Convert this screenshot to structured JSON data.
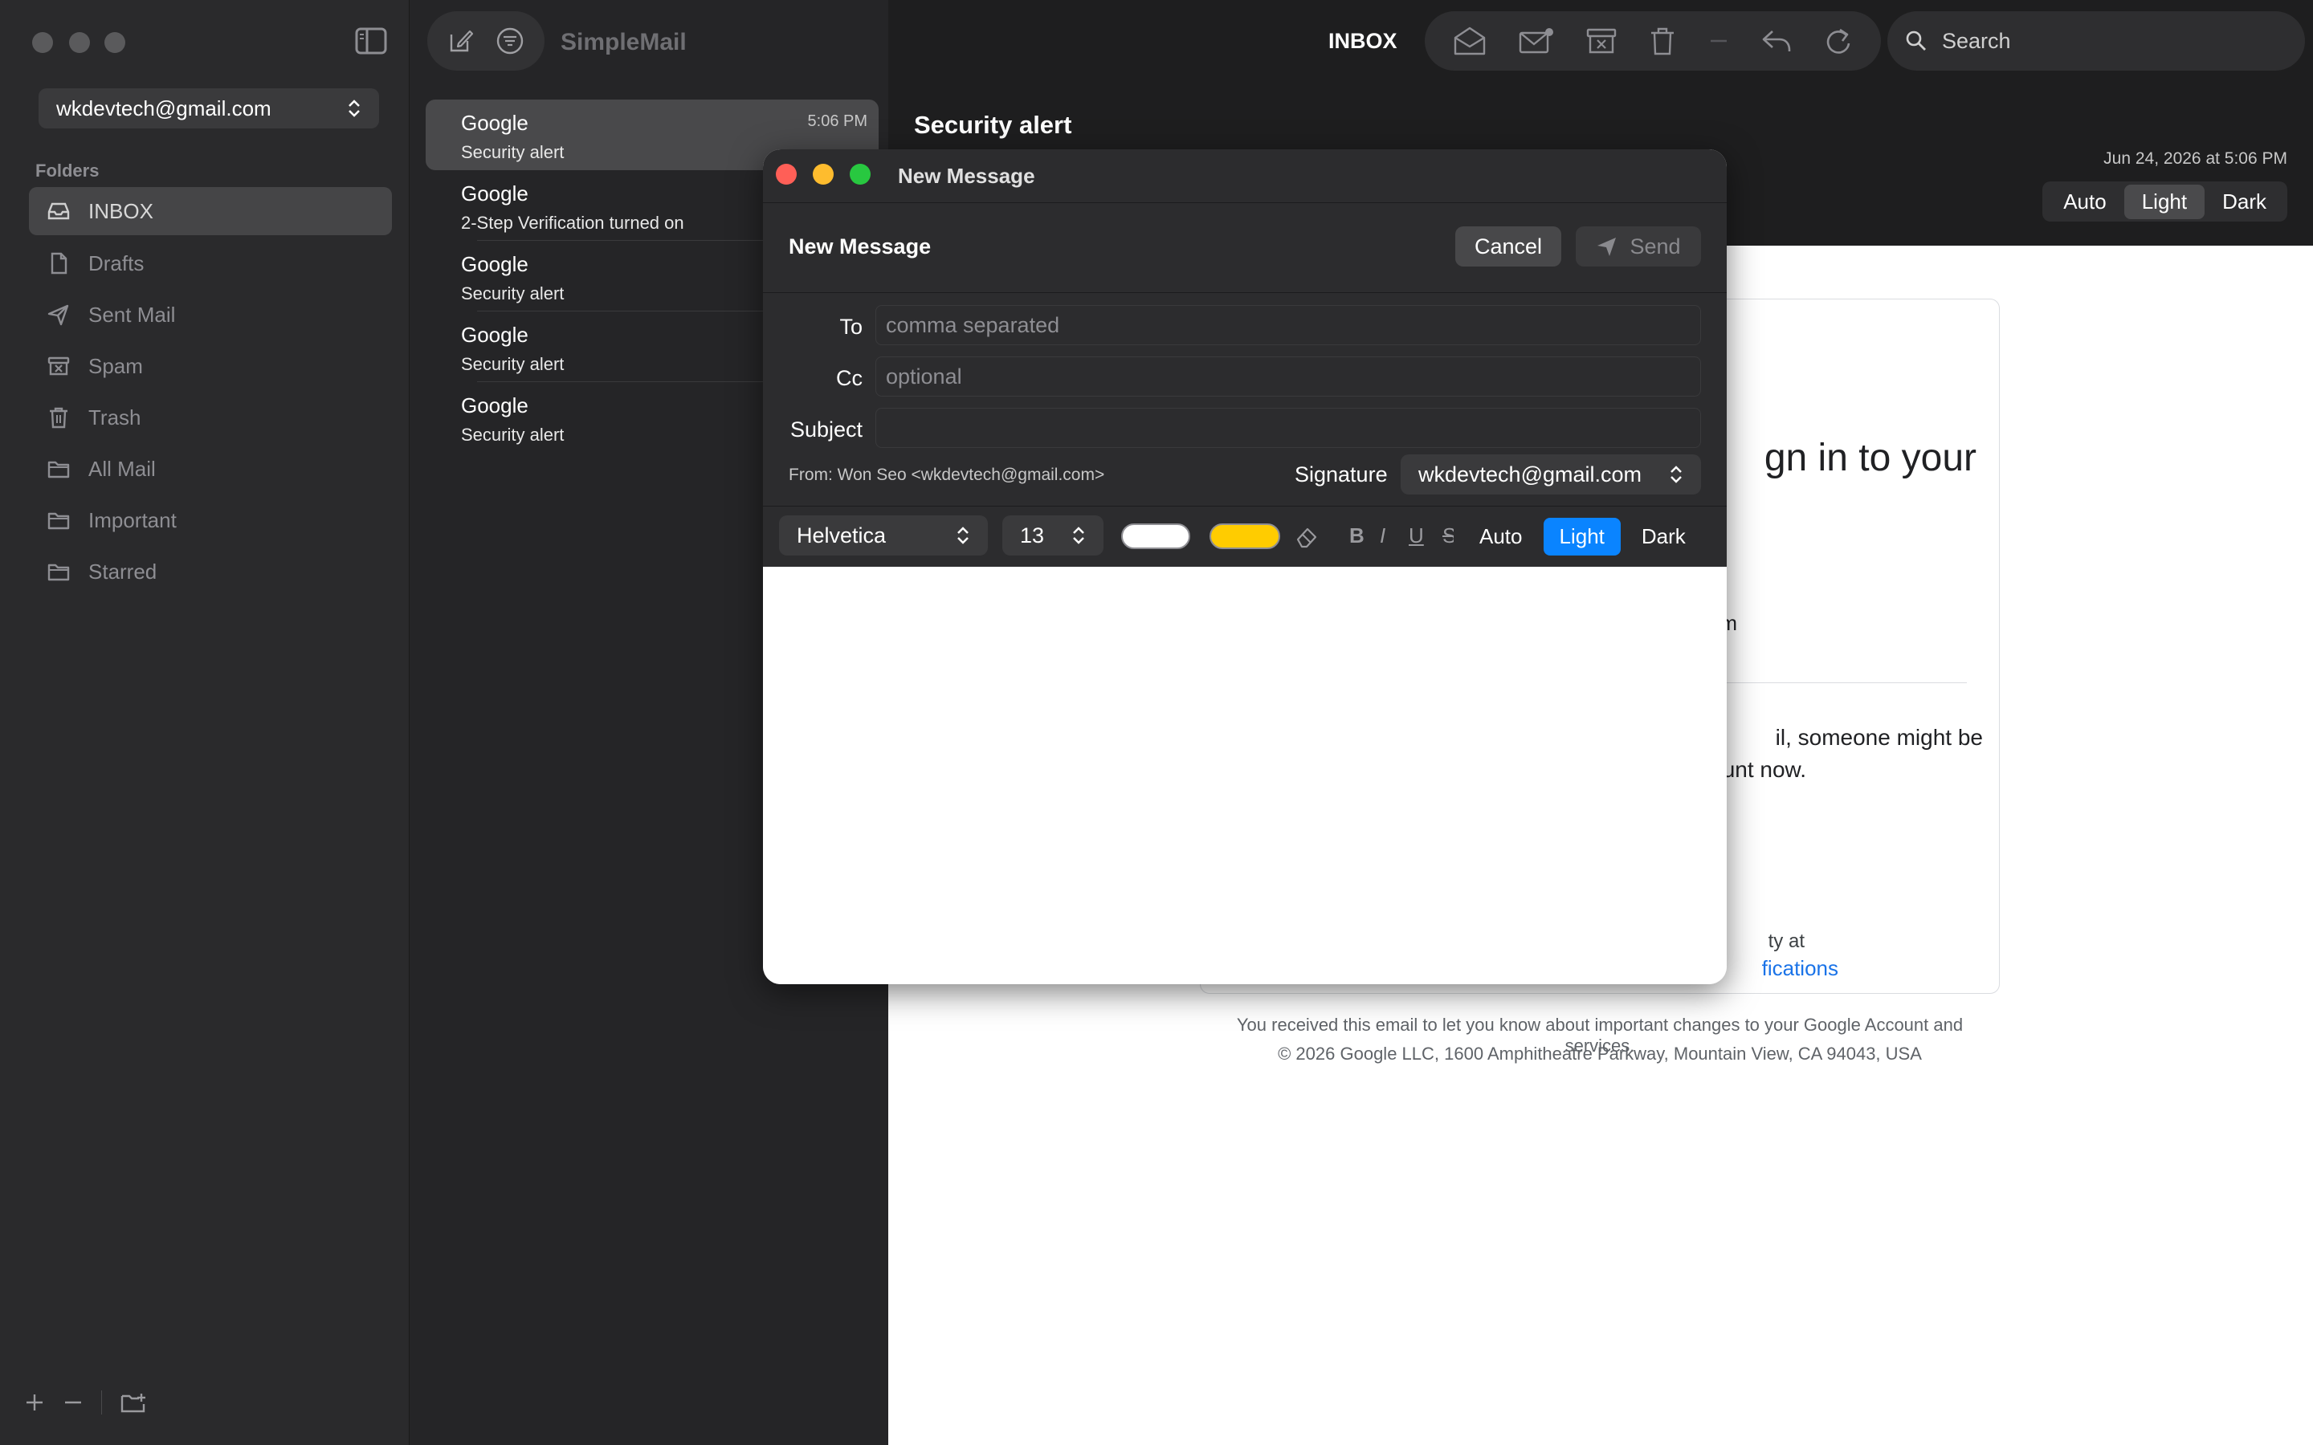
{
  "sidebar": {
    "account": "wkdevtech@gmail.com",
    "folders_label": "Folders",
    "folders": [
      {
        "label": "INBOX",
        "icon": "inbox-icon",
        "active": true
      },
      {
        "label": "Drafts",
        "icon": "document-icon"
      },
      {
        "label": "Sent Mail",
        "icon": "paperplane-icon"
      },
      {
        "label": "Spam",
        "icon": "spam-icon"
      },
      {
        "label": "Trash",
        "icon": "trash-icon"
      },
      {
        "label": "All Mail",
        "icon": "folder-icon"
      },
      {
        "label": "Important",
        "icon": "folder-icon"
      },
      {
        "label": "Starred",
        "icon": "folder-icon"
      }
    ]
  },
  "list": {
    "app_name": "SimpleMail",
    "messages": [
      {
        "sender": "Google",
        "subject": "Security alert",
        "time": "5:06 PM",
        "active": true
      },
      {
        "sender": "Google",
        "subject": "2-Step Verification turned on"
      },
      {
        "sender": "Google",
        "subject": "Security alert"
      },
      {
        "sender": "Google",
        "subject": "Security alert"
      },
      {
        "sender": "Google",
        "subject": "Security alert"
      }
    ]
  },
  "reader": {
    "mailbox": "INBOX",
    "search_placeholder": "Search",
    "subject": "Security alert",
    "date": "Jun 24, 2026 at 5:06 PM",
    "theme": {
      "auto": "Auto",
      "light": "Light",
      "dark": "Dark"
    },
    "card": {
      "heading_fragment": "gn in to your",
      "email_fragment": "m",
      "body_fragment_1": "il, someone might be",
      "body_fragment_2": "unt now.",
      "small_fragment": "ty at",
      "link_fragment": "fications"
    },
    "footer_1": "You received this email to let you know about important changes to your Google Account and services.",
    "footer_2": "© 2026 Google LLC, 1600 Amphitheatre Parkway, Mountain View, CA 94043, USA"
  },
  "compose": {
    "window_title": "New Message",
    "heading": "New Message",
    "cancel": "Cancel",
    "send": "Send",
    "to_label": "To",
    "to_placeholder": "comma separated",
    "cc_label": "Cc",
    "cc_placeholder": "optional",
    "subject_label": "Subject",
    "subject_value": "",
    "from": "From: Won Seo <wkdevtech@gmail.com>",
    "signature_label": "Signature",
    "signature_value": "wkdevtech@gmail.com",
    "font": "Helvetica",
    "size": "13",
    "text_color": "#ffffff",
    "highlight_color": "#ffcc00",
    "bold": "B",
    "italic": "I",
    "underline": "U",
    "strike": "S",
    "theme": {
      "auto": "Auto",
      "light": "Light",
      "dark": "Dark"
    }
  }
}
